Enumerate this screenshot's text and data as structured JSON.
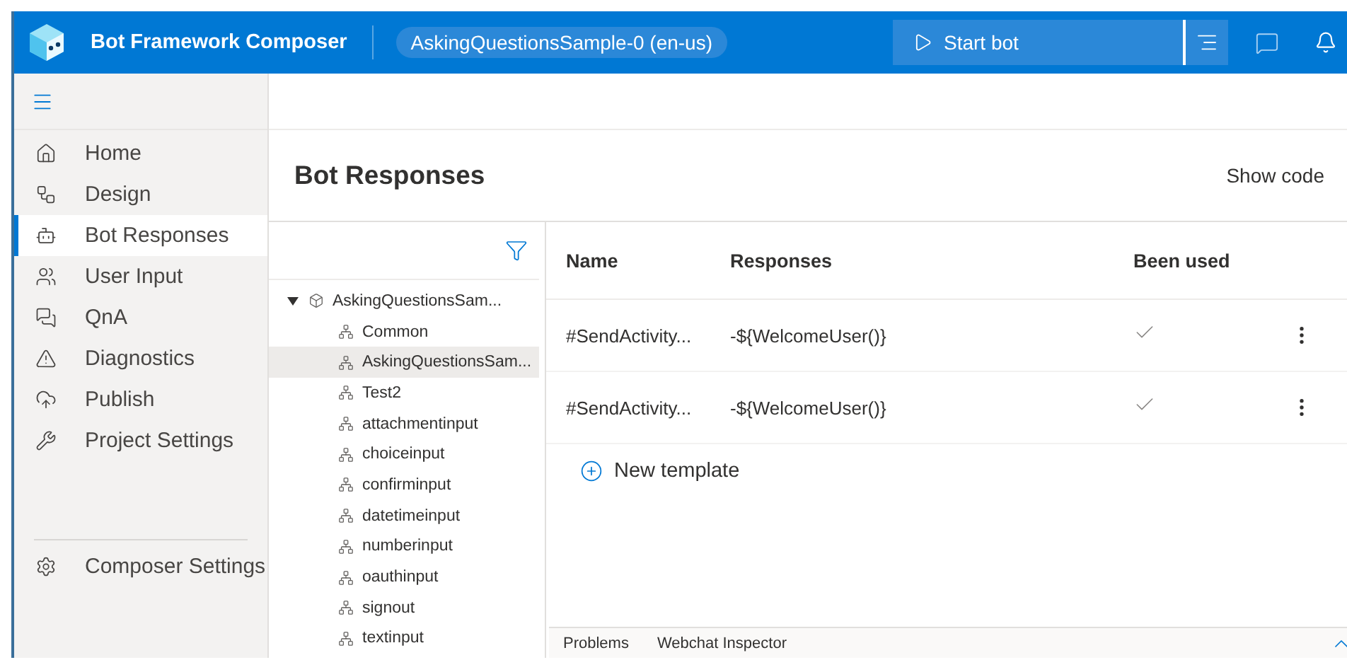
{
  "header": {
    "app_title": "Bot Framework Composer",
    "project": "AskingQuestionsSample-0 (en-us)",
    "start_button": "Start bot"
  },
  "nav": {
    "items": [
      {
        "label": "Home",
        "selected": false
      },
      {
        "label": "Design",
        "selected": false
      },
      {
        "label": "Bot Responses",
        "selected": true
      },
      {
        "label": "User Input",
        "selected": false
      },
      {
        "label": "QnA",
        "selected": false
      },
      {
        "label": "Diagnostics",
        "selected": false
      },
      {
        "label": "Publish",
        "selected": false
      },
      {
        "label": "Project Settings",
        "selected": false
      }
    ],
    "footer_item": {
      "label": "Composer Settings",
      "selected": false
    }
  },
  "page": {
    "title": "Bot Responses",
    "show_code": "Show code"
  },
  "tree": {
    "root": {
      "label": "AskingQuestionsSam...",
      "expanded": true,
      "children": [
        {
          "label": "Common",
          "selected": false
        },
        {
          "label": "AskingQuestionsSam...",
          "selected": true
        },
        {
          "label": "Test2",
          "selected": false
        },
        {
          "label": "attachmentinput",
          "selected": false
        },
        {
          "label": "choiceinput",
          "selected": false
        },
        {
          "label": "confirminput",
          "selected": false
        },
        {
          "label": "datetimeinput",
          "selected": false
        },
        {
          "label": "numberinput",
          "selected": false
        },
        {
          "label": "oauthinput",
          "selected": false
        },
        {
          "label": "signout",
          "selected": false
        },
        {
          "label": "textinput",
          "selected": false
        }
      ]
    }
  },
  "table": {
    "columns": [
      "Name",
      "Responses",
      "Been used"
    ],
    "rows": [
      {
        "name": "#SendActivity...",
        "response": "-${WelcomeUser()}",
        "used": true
      },
      {
        "name": "#SendActivity...",
        "response": "-${WelcomeUser()}",
        "used": true
      }
    ],
    "new_template": "New template"
  },
  "bottom_panel": {
    "tabs": [
      "Problems",
      "Webchat Inspector"
    ]
  }
}
